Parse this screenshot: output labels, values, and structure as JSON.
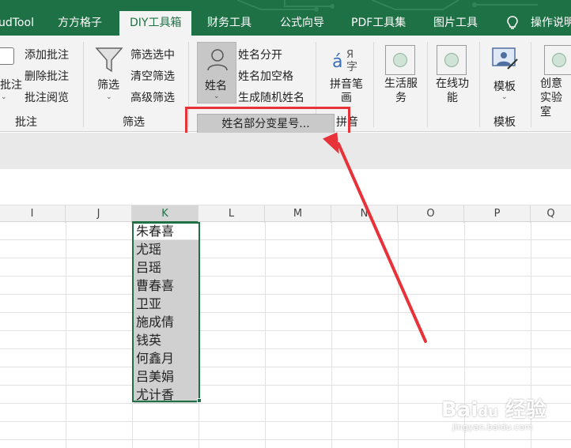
{
  "colors": {
    "ribbon_green": "#1e7145",
    "highlight_red": "#e8323a",
    "selection_gray": "#d0d0d0"
  },
  "tabs": [
    {
      "label": "udTool"
    },
    {
      "label": "方方格子"
    },
    {
      "label": "DIY工具箱",
      "active": true
    },
    {
      "label": "财务工具"
    },
    {
      "label": "公式向导"
    },
    {
      "label": "PDF工具集"
    },
    {
      "label": "图片工具"
    },
    {
      "label": "操作说明"
    }
  ],
  "ribbon": {
    "comment": {
      "pizhu_left": "批注",
      "add": "添加批注",
      "delete": "删除批注",
      "view": "批注阅览",
      "group": "批注"
    },
    "filter": {
      "button": "筛选",
      "filter_selected": "筛选选中",
      "clear": "清空筛选",
      "advanced": "高级筛选",
      "group": "筛选"
    },
    "name": {
      "button": "姓名",
      "split": "姓名分开",
      "add_space": "姓名加空格",
      "random": "生成随机姓名"
    },
    "pinyin": {
      "button": "拼音笔画",
      "group": "拼音"
    },
    "life": {
      "label": "生活服务"
    },
    "online": {
      "label": "在线功能"
    },
    "template": {
      "label": "模板",
      "group": "模板"
    },
    "creative": {
      "label": "创意实验室"
    }
  },
  "dropdown": {
    "item": "姓名部分变星号..."
  },
  "columns": [
    "I",
    "J",
    "K",
    "L",
    "M",
    "N",
    "O",
    "P",
    "Q"
  ],
  "cells": [
    "朱春喜",
    "尤瑶",
    "吕瑶",
    "曹春喜",
    "卫亚",
    "施成倩",
    "钱英",
    "何鑫月",
    "吕美娟",
    "尤计香"
  ],
  "watermark": {
    "main": "Bai 经验",
    "sub": "jingyan.baidu.com"
  }
}
